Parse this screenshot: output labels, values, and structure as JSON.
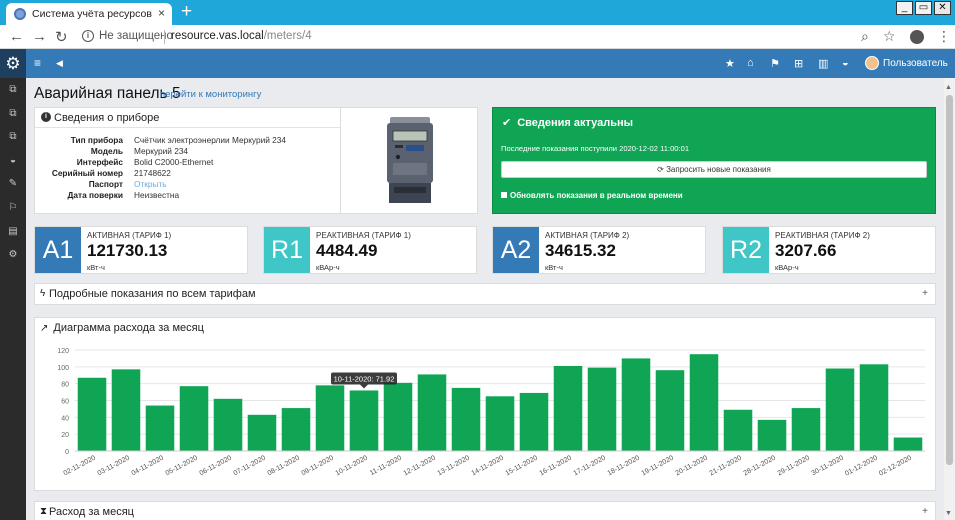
{
  "browser": {
    "tab_title": "Система учёта ресурсов",
    "tab_close": "×",
    "new_tab": "+",
    "security_label": "Не защищено",
    "url_host": "resource.vas.local",
    "url_path": "/meters/4",
    "window_buttons": [
      "_",
      "▭",
      "✕"
    ]
  },
  "app_nav": {
    "user_label": "Пользователь",
    "icons": [
      "star-icon",
      "institution-icon",
      "flag-icon",
      "sitemap-icon",
      "building-icon",
      "dashboard-icon"
    ]
  },
  "page": {
    "title": "Аварийная панель 5",
    "monitor_link": "перейти к мониторингу"
  },
  "device_info": {
    "heading": "Сведения о приборе",
    "rows": [
      {
        "key": "Тип прибора",
        "value": "Счётчик электроэнерлии Меркурий 234"
      },
      {
        "key": "Модель",
        "value": "Меркурий 234"
      },
      {
        "key": "Интерфейс",
        "value": "Bolid C2000-Ethernet"
      },
      {
        "key": "Серийный номер",
        "value": "21748622"
      },
      {
        "key": "Паспорт",
        "value": "Открыть"
      },
      {
        "key": "Дата поверки",
        "value": "Неизвестна"
      }
    ]
  },
  "status": {
    "title": "Сведения актуальны",
    "last_readings": "Последние показания поступили 2020-12-02 11:00:01",
    "request_button": "Запросить новые показания",
    "realtime_label": "Обновлять показания в реальном времени",
    "bg_color": "#0fa554"
  },
  "tariffs": [
    {
      "badge": "A1",
      "label": "АКТИВНАЯ (ТАРИФ 1)",
      "value": "121730.13",
      "unit": "кВт-ч",
      "color": "#337ab7"
    },
    {
      "badge": "R1",
      "label": "РЕАКТИВНАЯ (ТАРИФ 1)",
      "value": "4484.49",
      "unit": "кВАр-ч",
      "color": "#3fc6c6"
    },
    {
      "badge": "A2",
      "label": "АКТИВНАЯ (ТАРИФ 2)",
      "value": "34615.32",
      "unit": "кВт-ч",
      "color": "#337ab7"
    },
    {
      "badge": "R2",
      "label": "РЕАКТИВНАЯ (ТАРИФ 2)",
      "value": "3207.66",
      "unit": "кВАр-ч",
      "color": "#3fc6c6"
    }
  ],
  "detailed_panel": {
    "title": "Подробные показания по всем тарифам",
    "toggle": "+"
  },
  "month_panel": {
    "title": "Расход за месяц",
    "toggle": "+"
  },
  "chart_panel_title": "Диаграмма расхода за месяц",
  "chart_data": {
    "type": "bar",
    "bar_color": "#0fa554",
    "categories": [
      "02-11-2020",
      "03-11-2020",
      "04-11-2020",
      "05-11-2020",
      "06-11-2020",
      "07-11-2020",
      "08-11-2020",
      "09-11-2020",
      "10-11-2020",
      "11-11-2020",
      "12-11-2020",
      "13-11-2020",
      "14-11-2020",
      "15-11-2020",
      "16-11-2020",
      "17-11-2020",
      "18-11-2020",
      "19-11-2020",
      "20-11-2020",
      "21-11-2020",
      "28-11-2020",
      "29-11-2020",
      "30-11-2020",
      "01-12-2020",
      "02-12-2020"
    ],
    "values": [
      87,
      97,
      54,
      77,
      62,
      43,
      51,
      78,
      71.92,
      81,
      91,
      75,
      65,
      69,
      101,
      99,
      110,
      96,
      115,
      49,
      37,
      51,
      98,
      103,
      16
    ],
    "ylim": [
      0,
      120
    ],
    "yticks": [
      0,
      20,
      40,
      60,
      80,
      100,
      120
    ],
    "tooltip": {
      "category_index": 8,
      "text": "10-11-2020: 71.92"
    },
    "title": "",
    "xlabel": "",
    "ylabel": ""
  }
}
